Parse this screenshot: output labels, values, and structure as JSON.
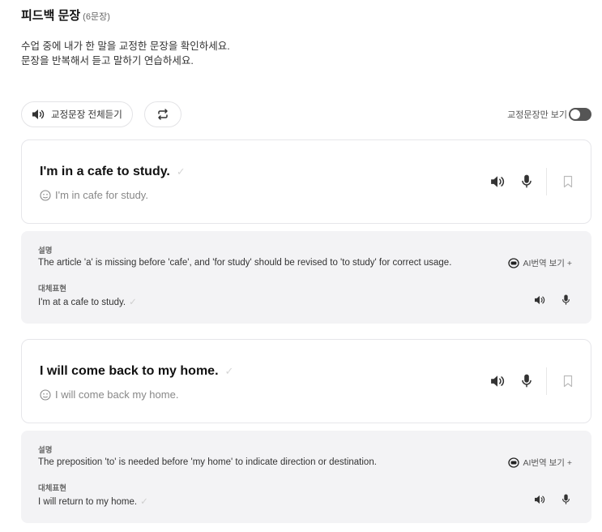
{
  "header": {
    "title": "피드백 문장",
    "count": "(6문장)",
    "desc_line1": "수업 중에 내가 한 말을 교정한 문장을 확인하세요.",
    "desc_line2": "문장을 반복해서 듣고 말하기 연습하세요."
  },
  "toolbar": {
    "listen_all": "교정문장 전체듣기",
    "toggle_label": "교정문장만 보기",
    "toggle_on": false
  },
  "labels": {
    "explanation": "설명",
    "alternative": "대체표현",
    "ai_translate": "AI번역 보기 +",
    "check": "✓"
  },
  "items": [
    {
      "corrected": "I'm in a cafe to study.",
      "original": "I'm in cafe for study.",
      "explanation": "The article 'a' is missing before 'cafe', and 'for study' should be revised to 'to study' for correct usage.",
      "alternative": "I'm at a cafe to study."
    },
    {
      "corrected": "I will come back to my home.",
      "original": "I will come back my home.",
      "explanation": "The preposition 'to' is needed before 'my home' to indicate direction or destination.",
      "alternative": "I will return to my home."
    }
  ]
}
